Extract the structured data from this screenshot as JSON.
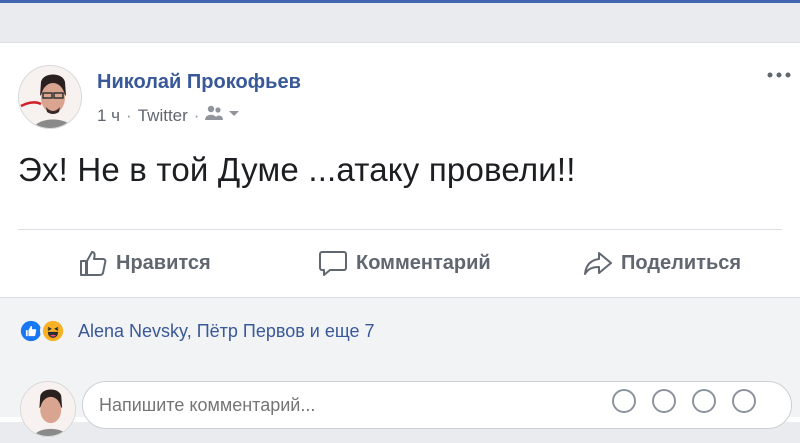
{
  "post": {
    "author": "Николай Прокофьев",
    "time": "1 ч",
    "source": "Twitter",
    "separator": "·",
    "text": "Эх! Не в той Думе ...атаку провели!!"
  },
  "actions": {
    "like": "Нравится",
    "comment": "Комментарий",
    "share": "Поделиться"
  },
  "reactions": {
    "summary": "Alena Nevsky, Пётр Первов и еще 7",
    "icons": [
      "like-icon",
      "haha-icon"
    ]
  },
  "comment_box": {
    "placeholder": "Напишите комментарий..."
  },
  "colors": {
    "brand": "#4267b2",
    "link": "#385898",
    "muted": "#606770",
    "bar_bg": "#f2f3f5"
  }
}
